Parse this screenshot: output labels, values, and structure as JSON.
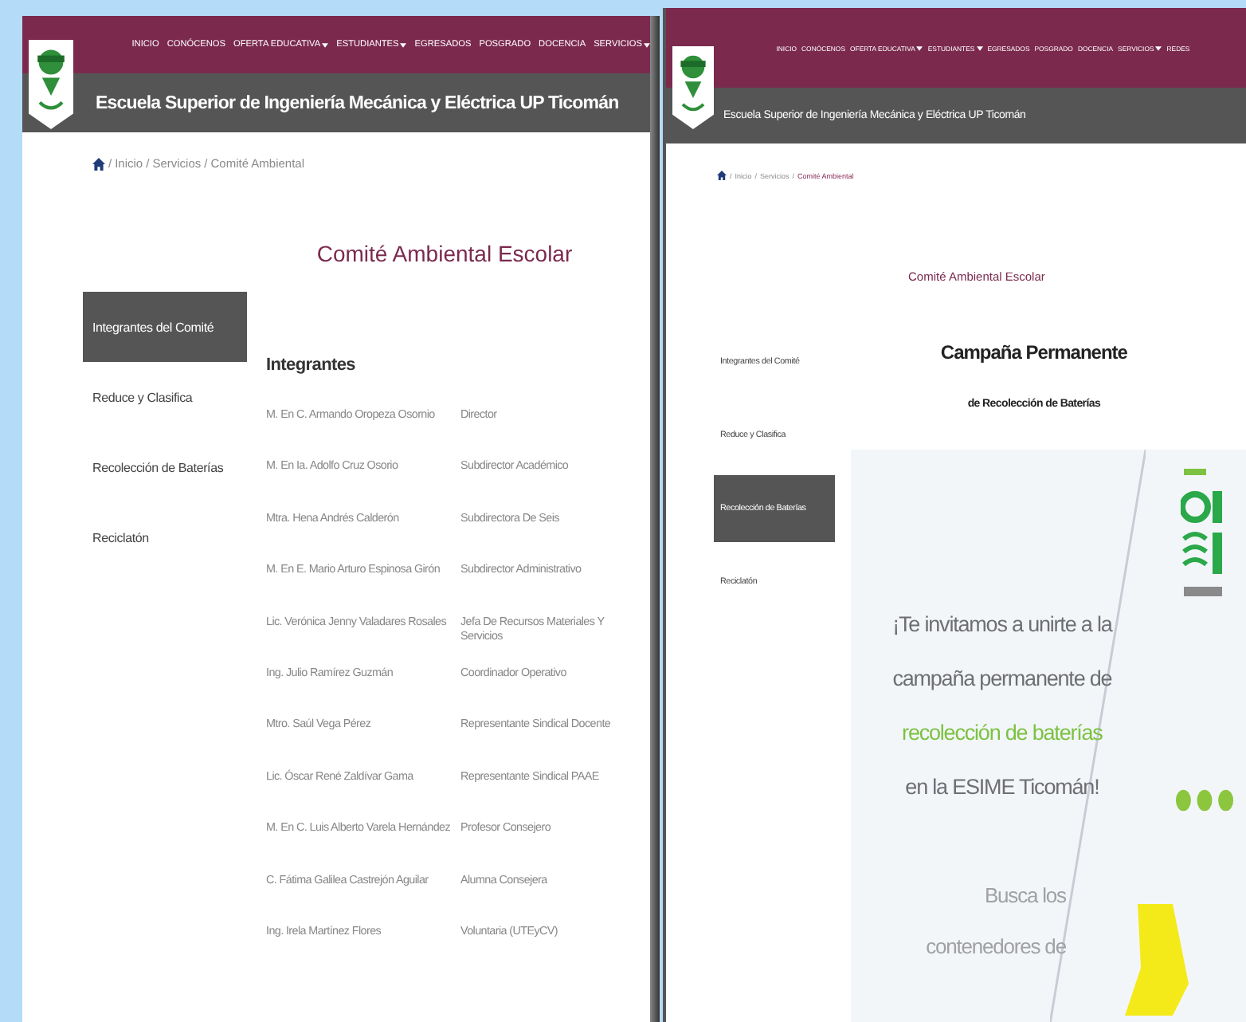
{
  "windows": [
    {
      "nav": [
        {
          "label": "INICIO",
          "dropdown": false
        },
        {
          "label": "CONÓCENOS",
          "dropdown": false
        },
        {
          "label": "OFERTA EDUCATIVA",
          "dropdown": true
        },
        {
          "label": "ESTUDIANTES",
          "dropdown": true
        },
        {
          "label": "EGRESADOS",
          "dropdown": false
        },
        {
          "label": "POSGRADO",
          "dropdown": false
        },
        {
          "label": "DOCENCIA",
          "dropdown": false
        },
        {
          "label": "SERVICIOS",
          "dropdown": true
        }
      ],
      "site_title": "Escuela Superior de Ingeniería Mecánica y Eléctrica UP Ticomán",
      "breadcrumb": {
        "separator": "/",
        "items": [
          {
            "label": "Inicio",
            "selected": false
          },
          {
            "label": "Servicios",
            "selected": false
          },
          {
            "label": "Comité Ambiental",
            "selected": false
          }
        ]
      },
      "page_title": "Comité Ambiental Escolar",
      "sidebar": [
        {
          "label": "Integrantes del Comité",
          "selected": true
        },
        {
          "label": "Reduce y Clasifica",
          "selected": false
        },
        {
          "label": "Recolección de Baterías",
          "selected": false
        },
        {
          "label": "Reciclatón",
          "selected": false
        }
      ],
      "content": {
        "kind": "members",
        "heading": "Integrantes",
        "rows": [
          {
            "name": "M. En C. Armando Oropeza Osornio",
            "role": "Director"
          },
          {
            "name": "M. En Ia. Adolfo Cruz Osorio",
            "role": "Subdirector Académico"
          },
          {
            "name": "Mtra. Hena Andrés Calderón",
            "role": "Subdirectora De Seis"
          },
          {
            "name": "M. En E. Mario Arturo Espinosa Girón",
            "role": "Subdirector Administrativo"
          },
          {
            "name": "Lic. Verónica Jenny Valadares Rosales",
            "role": "Jefa De Recursos Materiales Y Servicios"
          },
          {
            "name": "Ing. Julio Ramírez Guzmán",
            "role": "Coordinador Operativo"
          },
          {
            "name": "Mtro. Saúl Vega Pérez",
            "role": "Representante Sindical Docente"
          },
          {
            "name": "Lic. Óscar René Zaldívar Gama",
            "role": "Representante Sindical PAAE"
          },
          {
            "name": "M. En C. Luis Alberto Varela Hernández",
            "role": "Profesor Consejero"
          },
          {
            "name": "C. Fátima Galilea Castrejón Aguilar",
            "role": "Alumna Consejera"
          },
          {
            "name": "Ing. Irela Martínez Flores",
            "role": "Voluntaria (UTEyCV)"
          }
        ]
      }
    },
    {
      "nav": [
        {
          "label": "INICIO",
          "dropdown": false
        },
        {
          "label": "CONÓCENOS",
          "dropdown": false
        },
        {
          "label": "OFERTA EDUCATIVA",
          "dropdown": true
        },
        {
          "label": "ESTUDIANTES",
          "dropdown": true
        },
        {
          "label": "EGRESADOS",
          "dropdown": false
        },
        {
          "label": "POSGRADO",
          "dropdown": false
        },
        {
          "label": "DOCENCIA",
          "dropdown": false
        },
        {
          "label": "SERVICIOS",
          "dropdown": true
        },
        {
          "label": "REDES",
          "dropdown": false
        }
      ],
      "site_title": "Escuela Superior de Ingeniería Mecánica y Eléctrica UP Ticomán",
      "breadcrumb": {
        "separator": "/",
        "items": [
          {
            "label": "Inicio",
            "selected": false
          },
          {
            "label": "Servicios",
            "selected": false
          },
          {
            "label": "Comité Ambiental",
            "selected": true
          }
        ]
      },
      "page_title": "Comité Ambiental Escolar",
      "sidebar": [
        {
          "label": "Integrantes del Comité",
          "selected": false
        },
        {
          "label": "Reduce y Clasifica",
          "selected": false
        },
        {
          "label": "Recolección de Baterías",
          "selected": true
        },
        {
          "label": "Reciclatón",
          "selected": false
        }
      ],
      "content": {
        "kind": "campaign",
        "title": "Campaña Permanente",
        "subtitle": "de Recolección de Baterías",
        "poster": {
          "lines": [
            {
              "text": "¡Te invitamos a  unirte a la",
              "kind": "plain"
            },
            {
              "text": "campaña permanente de",
              "kind": "plain"
            },
            {
              "text": "recolección de baterías",
              "kind": "highlight"
            },
            {
              "text": "en la ESIME Ticomán!",
              "kind": "plain"
            }
          ],
          "note": [
            "Busca los",
            "contenedores de"
          ]
        }
      }
    }
  ]
}
